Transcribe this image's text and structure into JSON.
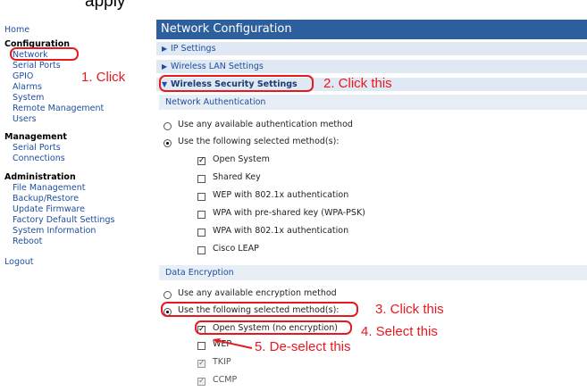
{
  "banner": {
    "text": "apply"
  },
  "sidebar": {
    "home": "Home",
    "configuration_head": "Configuration",
    "config_items": [
      "Network",
      "Serial Ports",
      "GPIO",
      "Alarms",
      "System",
      "Remote Management",
      "Users"
    ],
    "management_head": "Management",
    "management_items": [
      "Serial Ports",
      "Connections"
    ],
    "administration_head": "Administration",
    "admin_items": [
      "File Management",
      "Backup/Restore",
      "Update Firmware",
      "Factory Default Settings",
      "System Information",
      "Reboot"
    ],
    "logout": "Logout"
  },
  "main": {
    "title": "Network Configuration",
    "sections": {
      "ip": "IP Settings",
      "wlan": "Wireless LAN Settings",
      "security": "Wireless Security Settings"
    },
    "auth": {
      "heading": "Network Authentication",
      "any_method": "Use any available authentication method",
      "selected_methods": "Use the following selected method(s):",
      "methods": [
        "Open System",
        "Shared Key",
        "WEP with 802.1x authentication",
        "WPA with pre-shared key (WPA-PSK)",
        "WPA with 802.1x authentication",
        "Cisco LEAP"
      ]
    },
    "encryption": {
      "heading": "Data Encryption",
      "any_method": "Use any available encryption method",
      "selected_methods": "Use the following selected method(s):",
      "methods": [
        "Open System (no encryption)",
        "WEP",
        "TKIP",
        "CCMP"
      ]
    }
  },
  "annotations": {
    "step1": "1. Click",
    "step2": "2. Click this",
    "step3": "3. Click this",
    "step4": "4. Select this",
    "step5": "5. De-select this"
  },
  "colors": {
    "accent": "#2d5f9c",
    "annotation": "#e8191e",
    "link": "#1f4fa0"
  }
}
